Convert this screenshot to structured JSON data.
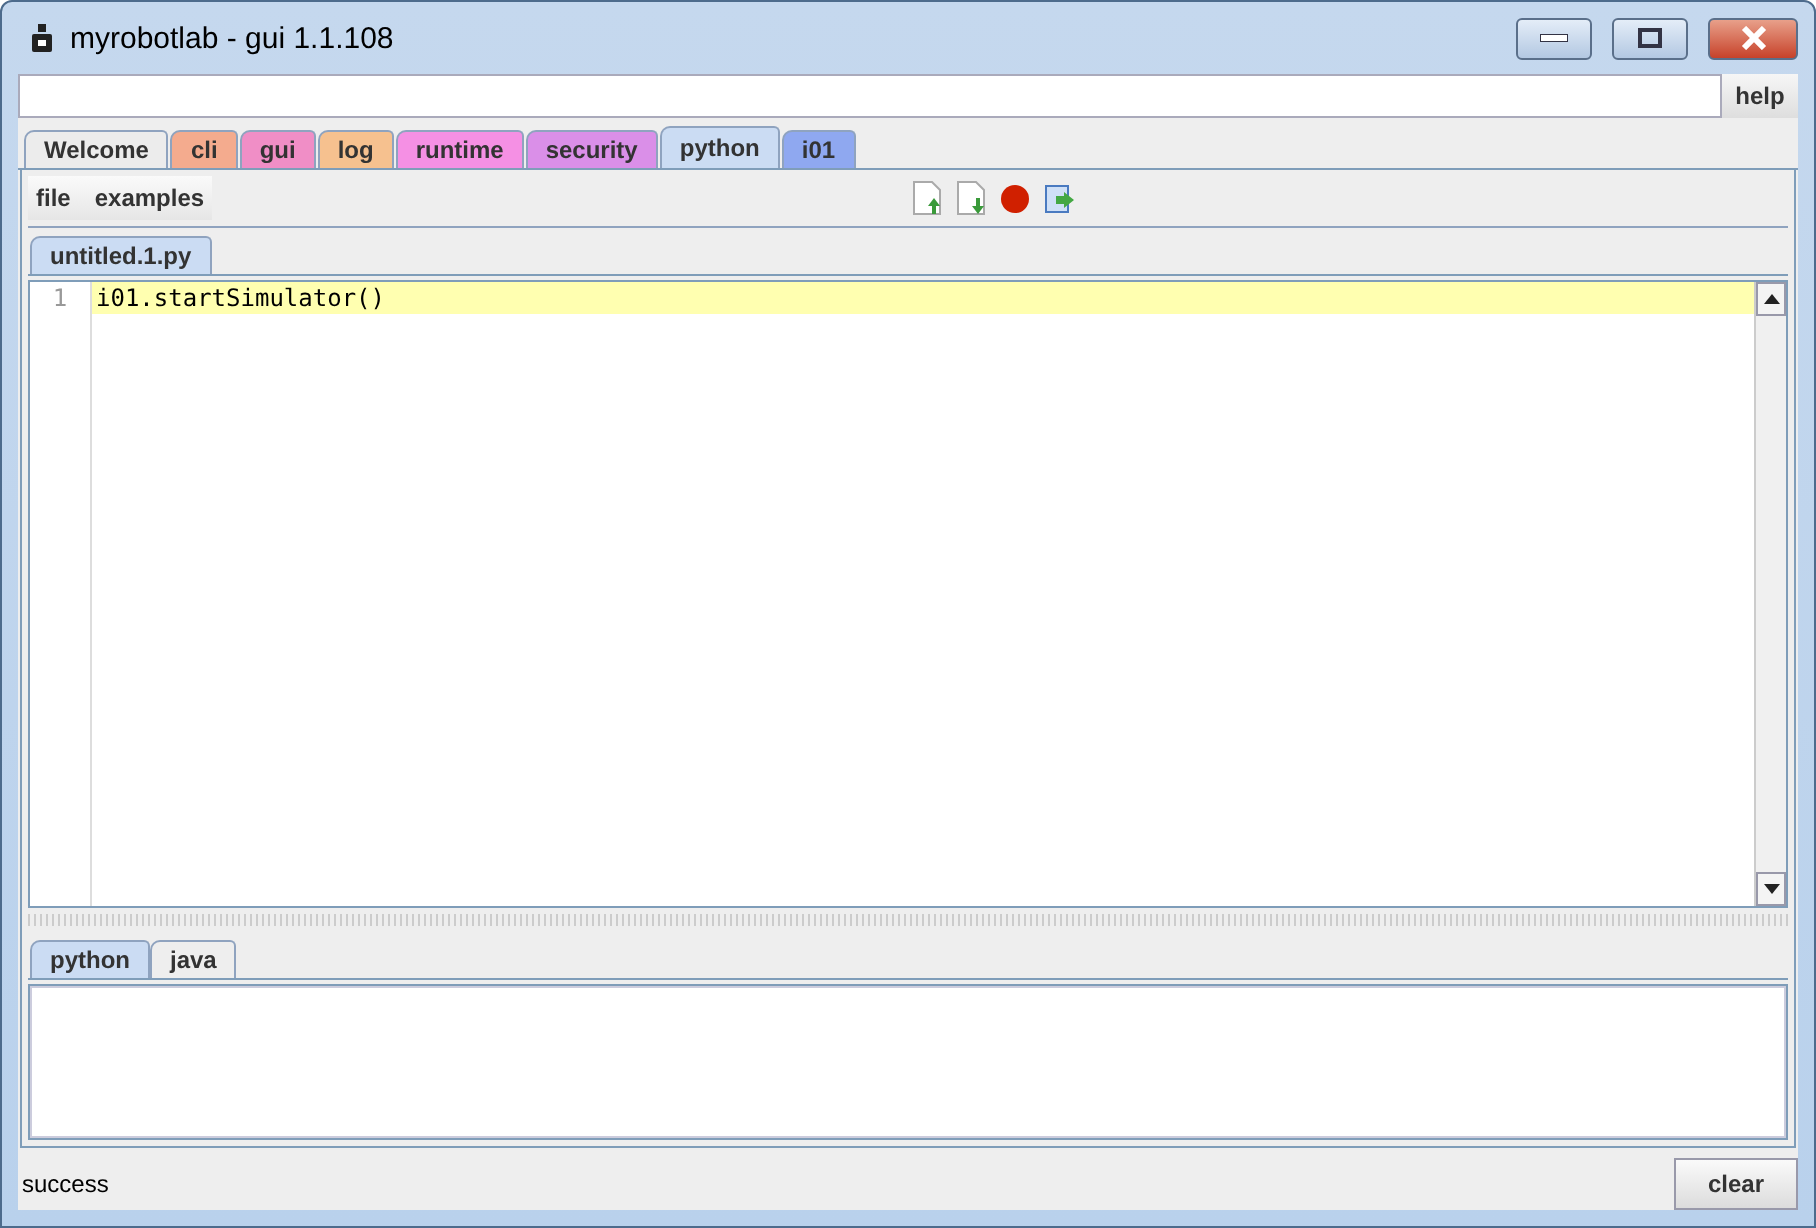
{
  "window": {
    "title": "myrobotlab - gui 1.1.108"
  },
  "command": {
    "help": "help"
  },
  "tabs": [
    {
      "label": "Welcome",
      "color": "#ececec",
      "selected": false
    },
    {
      "label": "cli",
      "color": "#f4ab8e",
      "selected": false
    },
    {
      "label": "gui",
      "color": "#f08ec6",
      "selected": false
    },
    {
      "label": "log",
      "color": "#f6c18f",
      "selected": false
    },
    {
      "label": "runtime",
      "color": "#f590e4",
      "selected": false
    },
    {
      "label": "security",
      "color": "#da8fe8",
      "selected": false
    },
    {
      "label": "python",
      "color": "#cbdcf3",
      "selected": true
    },
    {
      "label": "i01",
      "color": "#8fa8f0",
      "selected": false
    }
  ],
  "menu": [
    "file",
    "examples"
  ],
  "editor_tabs": [
    {
      "label": "untitled.1.py",
      "selected": true
    }
  ],
  "editor": {
    "lines": [
      {
        "number": "1",
        "code": "i01.startSimulator()",
        "current": true
      }
    ]
  },
  "output_tabs": [
    {
      "label": "python",
      "selected": true
    },
    {
      "label": "java",
      "selected": false
    }
  ],
  "status_bar": {
    "text": "success",
    "button": "clear"
  }
}
